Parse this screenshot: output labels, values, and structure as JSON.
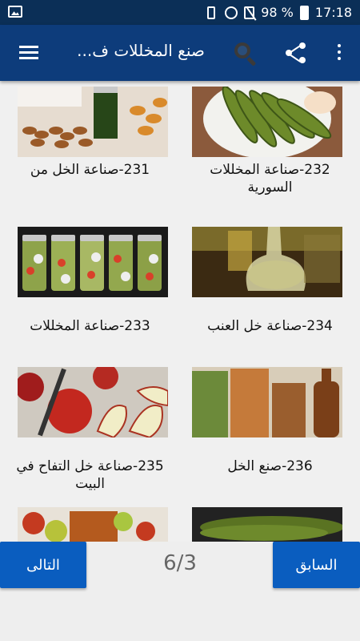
{
  "status_bar": {
    "battery_percent": "98 %",
    "time": "17:18"
  },
  "app_bar": {
    "title": "صنع المخللات ف...",
    "icons": [
      "menu-icon",
      "search-icon",
      "share-icon",
      "overflow-menu-icon"
    ]
  },
  "cards": [
    {
      "title": "232-صناعة المخللات السورية",
      "image": "pickled-cucumbers-plate"
    },
    {
      "title": "231-صناعة الخل من",
      "image": "dates-and-bottle"
    },
    {
      "title": "234-صناعة خل العنب",
      "image": "vinegar-glass-cruet"
    },
    {
      "title": "233-صناعة المخللات",
      "image": "pickle-jars-row"
    },
    {
      "title": "236-صنع الخل",
      "image": "vinegar-jars-bottle"
    },
    {
      "title": "235-صناعة خل التفاح في البيت",
      "image": "sliced-apples"
    },
    {
      "title": "",
      "image": "cucumber-pickles-close"
    },
    {
      "title": "",
      "image": "apples-with-drink"
    }
  ],
  "pagination": {
    "prev_label": "السابق",
    "next_label": "التالى",
    "page_indicator": "6/3"
  },
  "colors": {
    "status_bar": "#0b2f57",
    "app_bar": "#0d3c7b",
    "button": "#0a5dbf"
  }
}
